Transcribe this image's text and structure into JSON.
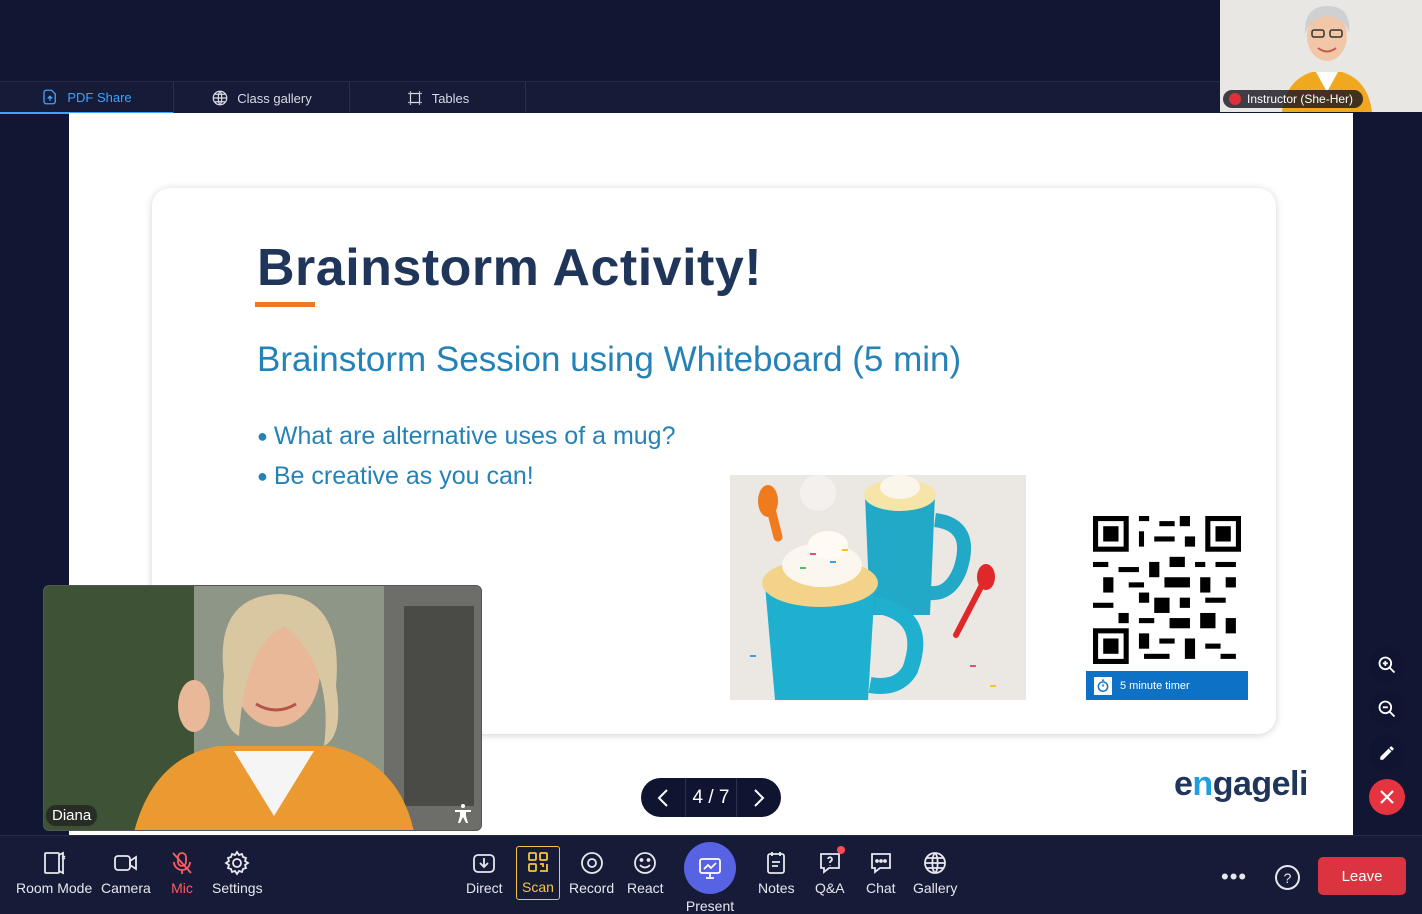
{
  "tabs": [
    {
      "label": "PDF Share",
      "icon": "pdf-share-icon",
      "active": true
    },
    {
      "label": "Class gallery",
      "icon": "globe-icon",
      "active": false
    },
    {
      "label": "Tables",
      "icon": "tables-icon",
      "active": false
    }
  ],
  "instructor": {
    "name": "Instructor (She-Her)",
    "muted": true
  },
  "slide": {
    "title": "Brainstorm Activity!",
    "subtitle": "Brainstorm Session using Whiteboard (5 min)",
    "bullets": [
      "What are alternative uses of a mug?",
      "Be creative as you can!"
    ],
    "timer_label": "5 minute timer"
  },
  "pager": {
    "current": 4,
    "total": 7,
    "label": "4 / 7"
  },
  "logo": {
    "pre": "e",
    "accent": "n",
    "post": "gageli"
  },
  "participant": {
    "name": "Diana"
  },
  "toolbar": {
    "room_mode": "Room Mode",
    "camera": "Camera",
    "mic": "Mic",
    "settings": "Settings",
    "direct": "Direct",
    "scan": "Scan",
    "record": "Record",
    "react": "React",
    "present": "Present",
    "notes": "Notes",
    "qa": "Q&A",
    "chat": "Chat",
    "gallery": "Gallery",
    "more": "•••",
    "help": "?",
    "leave": "Leave"
  },
  "colors": {
    "background": "#111633",
    "accent_blue": "#3ea2ff",
    "present_purple": "#5863e3",
    "leave_red": "#dc3340",
    "title_navy": "#1f3559",
    "slide_blue": "#2582b7",
    "underline_orange": "#e97a2a"
  }
}
